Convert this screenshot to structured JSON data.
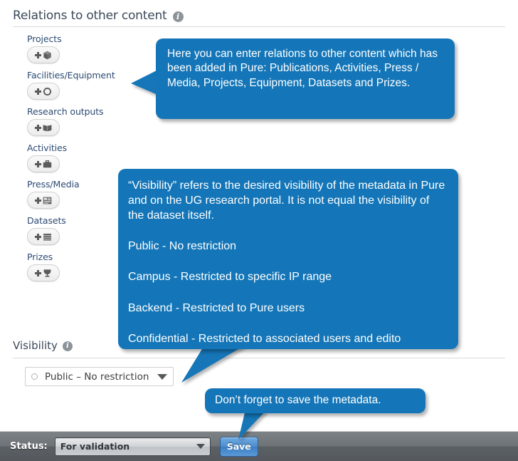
{
  "header": {
    "title": "Relations to other content",
    "info_icon": "info-icon"
  },
  "relations": {
    "items": [
      {
        "label": "Projects",
        "icon": "cube-icon",
        "button_label": "+"
      },
      {
        "label": "Facilities/Equipment",
        "icon": "circle-icon",
        "button_label": "+"
      },
      {
        "label": "Research outputs",
        "icon": "book-icon",
        "button_label": "+"
      },
      {
        "label": "Activities",
        "icon": "briefcase-icon",
        "button_label": "+"
      },
      {
        "label": "Press/Media",
        "icon": "newspaper-icon",
        "button_label": "+"
      },
      {
        "label": "Datasets",
        "icon": "list-icon",
        "button_label": "+"
      },
      {
        "label": "Prizes",
        "icon": "trophy-icon",
        "button_label": "+"
      }
    ]
  },
  "visibility": {
    "title": "Visibility",
    "info_icon": "info-icon",
    "selected": "Public – No restriction",
    "radio_icon": "radio-circle-icon",
    "caret_icon": "chevron-down-icon"
  },
  "status_bar": {
    "label": "Status:",
    "selected_status": "For validation",
    "caret_icon": "chevron-down-icon",
    "save_label": "Save"
  },
  "callouts": {
    "relations": {
      "text": "Here you can enter relations to other content which has been added in Pure: Publications, Activities, Press / Media, Projects, Equipment, Datasets and Prizes."
    },
    "visibility": {
      "paragraph1": "“Visibility” refers to the desired visibility of the metadata in Pure and on the UG research portal. It is not equal the visibility of the dataset itself.",
      "line_public": "Public - No restriction",
      "line_campus": "Campus - Restricted to specific IP range",
      "line_backend": "Backend - Restricted to Pure users",
      "line_confidential": "Confidential - Restricted to associated users and edito"
    },
    "save": {
      "text": "Don’t forget to save the metadata."
    }
  },
  "colors": {
    "callout_blue": "#1476b8",
    "label_blue": "#2c4a73",
    "header_gray": "#3b4a5a",
    "status_bar_gray": "#6e7378",
    "save_blue": "#4d8fd0"
  }
}
